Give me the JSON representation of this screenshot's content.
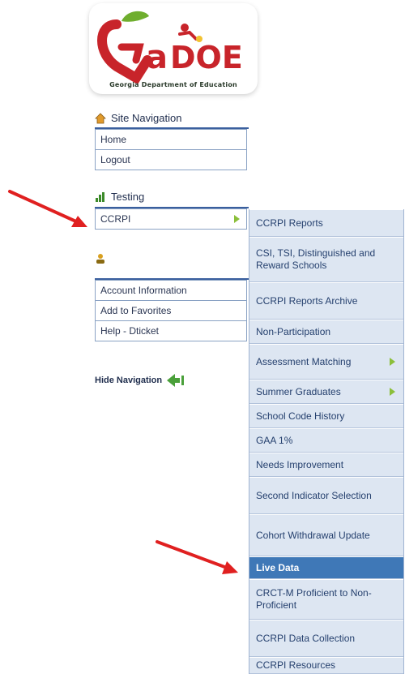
{
  "logo": {
    "tagline": "Georgia Department of Education"
  },
  "site_navigation": {
    "title": "Site Navigation",
    "items": [
      {
        "label": "Home"
      },
      {
        "label": "Logout"
      }
    ]
  },
  "testing": {
    "title": "Testing",
    "items": [
      {
        "label": "CCRPI"
      }
    ]
  },
  "account": {
    "items": [
      {
        "label": "Account Information"
      },
      {
        "label": "Add to Favorites"
      },
      {
        "label": "Help - Dticket"
      }
    ]
  },
  "hide_navigation": "Hide Navigation",
  "flyout": {
    "items": [
      {
        "label": "CCRPI Reports"
      },
      {
        "label": "CSI, TSI, Distinguished and Reward Schools"
      },
      {
        "label": "CCRPI Reports Archive"
      },
      {
        "label": "Non-Participation"
      },
      {
        "label": "Assessment Matching"
      },
      {
        "label": "Summer Graduates"
      },
      {
        "label": "School Code History"
      },
      {
        "label": "GAA 1%"
      },
      {
        "label": "Needs Improvement"
      },
      {
        "label": "Second Indicator Selection"
      },
      {
        "label": "Cohort Withdrawal Update"
      },
      {
        "label": "Live Data"
      },
      {
        "label": "CRCT-M Proficient to Non-Proficient"
      },
      {
        "label": "CCRPI Data Collection"
      },
      {
        "label": "CCRPI Resources"
      }
    ]
  },
  "colors": {
    "accent": "#3f78b7",
    "submenu_bg": "#dde6f2",
    "arrow_green": "#8bbf3a",
    "annotation_red": "#e02020"
  }
}
